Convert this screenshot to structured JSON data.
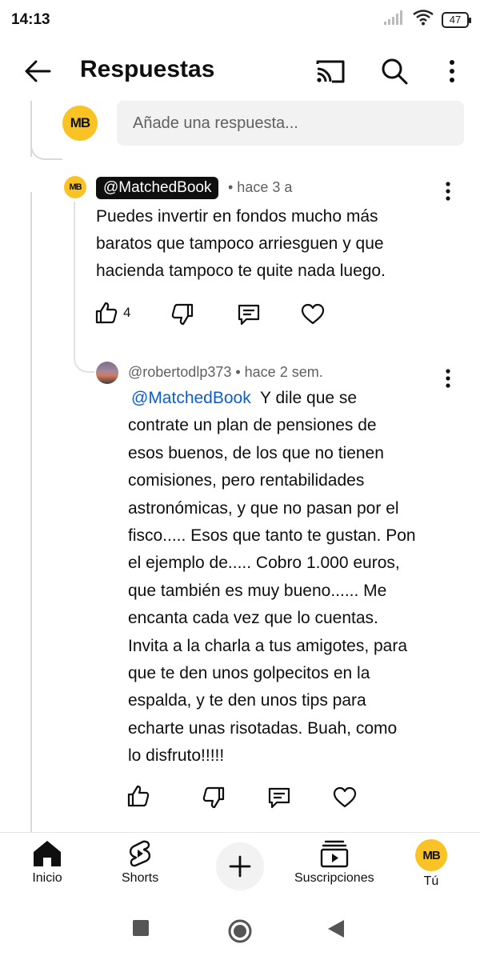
{
  "status": {
    "time": "14:13",
    "battery": "47"
  },
  "app_bar": {
    "title": "Respuestas"
  },
  "reply_box": {
    "avatar_text": "MB",
    "placeholder": "Añade una respuesta..."
  },
  "comment_1": {
    "avatar_text": "MB",
    "author": "@MatchedBook",
    "time": "• hace 3 a",
    "lines": [
      "Puedes invertir en fondos mucho más",
      "baratos que tampoco arriesguen y que",
      "hacienda tampoco te quite nada luego."
    ],
    "likes": "4"
  },
  "comment_2": {
    "author_time": "@robertodlp373 • hace 2 sem.",
    "mention": "@MatchedBook",
    "first_line_rest": "  Y dile que se",
    "lines": [
      "contrate un plan de pensiones de",
      "esos buenos, de los que no tienen",
      "comisiones, pero rentabilidades",
      "astronómicas, y que no pasan por el",
      "fisco..... Esos que tanto te gustan. Pon",
      "el ejemplo de..... Cobro 1.000 euros,",
      "que también es muy bueno...... Me",
      "encanta cada vez que lo cuentas.",
      "Invita a la charla a tus amigotes, para",
      "que te den unos golpecitos en la",
      "espalda, y te den unos tips para",
      "echarte unas risotadas. Buah, como",
      "lo disfruto!!!!!"
    ]
  },
  "bottom_nav": {
    "home": "Inicio",
    "shorts": "Shorts",
    "subscriptions": "Suscripciones",
    "you": "Tú",
    "you_avatar_text": "MB"
  },
  "colors": {
    "accent_link": "#065fd4",
    "avatar_yellow": "#f9c326",
    "text": "#0f0f0f",
    "secondary": "#606060"
  }
}
